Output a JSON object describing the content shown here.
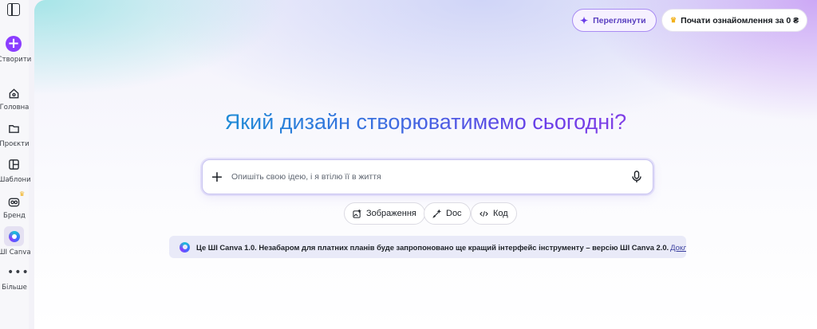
{
  "sidebar": {
    "create_label": "Створити",
    "items": [
      {
        "label": "Головна",
        "icon": "home-icon"
      },
      {
        "label": "Проєкти",
        "icon": "folder-icon"
      },
      {
        "label": "Шаблони",
        "icon": "templates-icon"
      },
      {
        "label": "Бренд",
        "icon": "brand-icon"
      },
      {
        "label": "ШІ Canva",
        "icon": "canva-ai-icon"
      },
      {
        "label": "Більше",
        "icon": "more-dots-icon"
      }
    ]
  },
  "header": {
    "review_label": "Переглянути",
    "trial_label": "Почати ознайомлення за 0 ₴"
  },
  "main": {
    "headline": "Який дизайн створюватимемо сьогодні?",
    "prompt_placeholder": "Опишіть свою ідею, і я втілю її в життя",
    "chips": [
      {
        "label": "Зображення",
        "icon": "image-icon"
      },
      {
        "label": "Doc",
        "icon": "doc-icon"
      },
      {
        "label": "Код",
        "icon": "code-icon"
      }
    ],
    "banner_text": "Це ШІ Canva 1.0. Незабаром для платних планів буде запропоновано ще кращий інтерфейс інструменту – версію ШІ Canva 2.0.",
    "banner_link": "Докладніше"
  },
  "colors": {
    "accent": "#8b3dff",
    "banner_bg": "#e9eaf8",
    "crown": "#f2b11b"
  }
}
